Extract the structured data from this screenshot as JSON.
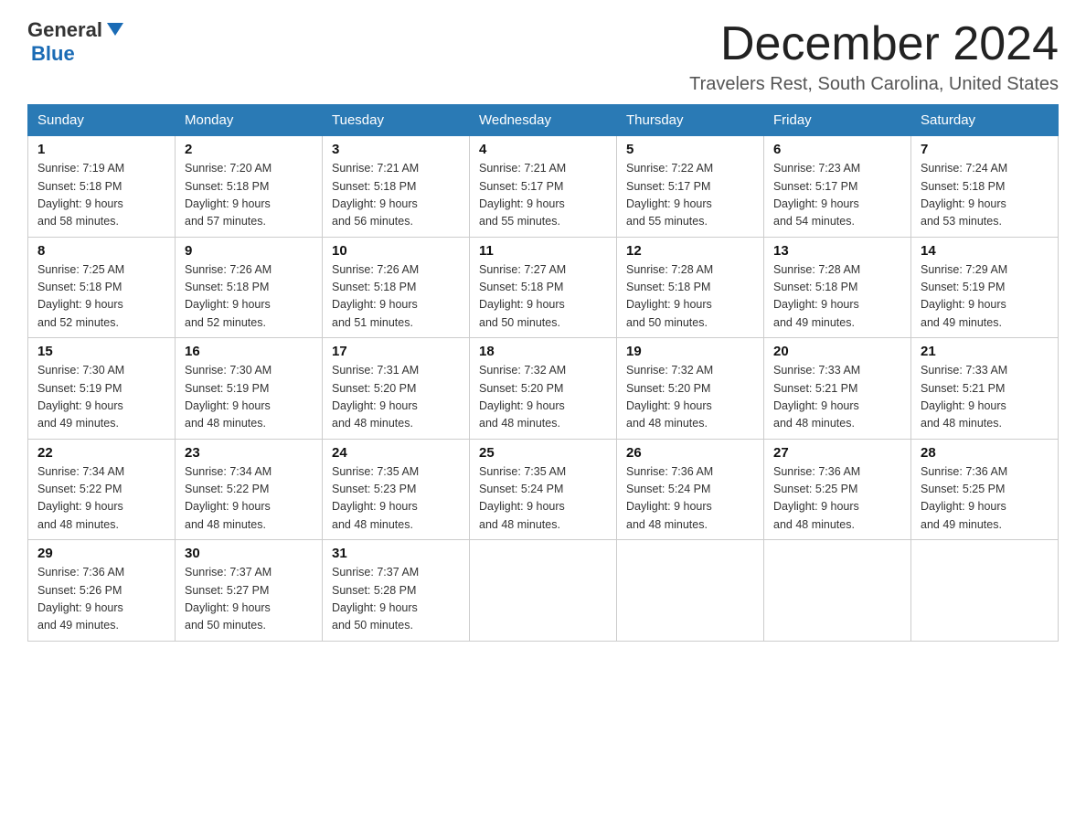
{
  "header": {
    "logo": {
      "general": "General",
      "blue": "Blue"
    },
    "title": "December 2024",
    "subtitle": "Travelers Rest, South Carolina, United States"
  },
  "weekdays": [
    "Sunday",
    "Monday",
    "Tuesday",
    "Wednesday",
    "Thursday",
    "Friday",
    "Saturday"
  ],
  "weeks": [
    [
      {
        "day": "1",
        "sunrise": "7:19 AM",
        "sunset": "5:18 PM",
        "daylight": "9 hours and 58 minutes."
      },
      {
        "day": "2",
        "sunrise": "7:20 AM",
        "sunset": "5:18 PM",
        "daylight": "9 hours and 57 minutes."
      },
      {
        "day": "3",
        "sunrise": "7:21 AM",
        "sunset": "5:18 PM",
        "daylight": "9 hours and 56 minutes."
      },
      {
        "day": "4",
        "sunrise": "7:21 AM",
        "sunset": "5:17 PM",
        "daylight": "9 hours and 55 minutes."
      },
      {
        "day": "5",
        "sunrise": "7:22 AM",
        "sunset": "5:17 PM",
        "daylight": "9 hours and 55 minutes."
      },
      {
        "day": "6",
        "sunrise": "7:23 AM",
        "sunset": "5:17 PM",
        "daylight": "9 hours and 54 minutes."
      },
      {
        "day": "7",
        "sunrise": "7:24 AM",
        "sunset": "5:18 PM",
        "daylight": "9 hours and 53 minutes."
      }
    ],
    [
      {
        "day": "8",
        "sunrise": "7:25 AM",
        "sunset": "5:18 PM",
        "daylight": "9 hours and 52 minutes."
      },
      {
        "day": "9",
        "sunrise": "7:26 AM",
        "sunset": "5:18 PM",
        "daylight": "9 hours and 52 minutes."
      },
      {
        "day": "10",
        "sunrise": "7:26 AM",
        "sunset": "5:18 PM",
        "daylight": "9 hours and 51 minutes."
      },
      {
        "day": "11",
        "sunrise": "7:27 AM",
        "sunset": "5:18 PM",
        "daylight": "9 hours and 50 minutes."
      },
      {
        "day": "12",
        "sunrise": "7:28 AM",
        "sunset": "5:18 PM",
        "daylight": "9 hours and 50 minutes."
      },
      {
        "day": "13",
        "sunrise": "7:28 AM",
        "sunset": "5:18 PM",
        "daylight": "9 hours and 49 minutes."
      },
      {
        "day": "14",
        "sunrise": "7:29 AM",
        "sunset": "5:19 PM",
        "daylight": "9 hours and 49 minutes."
      }
    ],
    [
      {
        "day": "15",
        "sunrise": "7:30 AM",
        "sunset": "5:19 PM",
        "daylight": "9 hours and 49 minutes."
      },
      {
        "day": "16",
        "sunrise": "7:30 AM",
        "sunset": "5:19 PM",
        "daylight": "9 hours and 48 minutes."
      },
      {
        "day": "17",
        "sunrise": "7:31 AM",
        "sunset": "5:20 PM",
        "daylight": "9 hours and 48 minutes."
      },
      {
        "day": "18",
        "sunrise": "7:32 AM",
        "sunset": "5:20 PM",
        "daylight": "9 hours and 48 minutes."
      },
      {
        "day": "19",
        "sunrise": "7:32 AM",
        "sunset": "5:20 PM",
        "daylight": "9 hours and 48 minutes."
      },
      {
        "day": "20",
        "sunrise": "7:33 AM",
        "sunset": "5:21 PM",
        "daylight": "9 hours and 48 minutes."
      },
      {
        "day": "21",
        "sunrise": "7:33 AM",
        "sunset": "5:21 PM",
        "daylight": "9 hours and 48 minutes."
      }
    ],
    [
      {
        "day": "22",
        "sunrise": "7:34 AM",
        "sunset": "5:22 PM",
        "daylight": "9 hours and 48 minutes."
      },
      {
        "day": "23",
        "sunrise": "7:34 AM",
        "sunset": "5:22 PM",
        "daylight": "9 hours and 48 minutes."
      },
      {
        "day": "24",
        "sunrise": "7:35 AM",
        "sunset": "5:23 PM",
        "daylight": "9 hours and 48 minutes."
      },
      {
        "day": "25",
        "sunrise": "7:35 AM",
        "sunset": "5:24 PM",
        "daylight": "9 hours and 48 minutes."
      },
      {
        "day": "26",
        "sunrise": "7:36 AM",
        "sunset": "5:24 PM",
        "daylight": "9 hours and 48 minutes."
      },
      {
        "day": "27",
        "sunrise": "7:36 AM",
        "sunset": "5:25 PM",
        "daylight": "9 hours and 48 minutes."
      },
      {
        "day": "28",
        "sunrise": "7:36 AM",
        "sunset": "5:25 PM",
        "daylight": "9 hours and 49 minutes."
      }
    ],
    [
      {
        "day": "29",
        "sunrise": "7:36 AM",
        "sunset": "5:26 PM",
        "daylight": "9 hours and 49 minutes."
      },
      {
        "day": "30",
        "sunrise": "7:37 AM",
        "sunset": "5:27 PM",
        "daylight": "9 hours and 50 minutes."
      },
      {
        "day": "31",
        "sunrise": "7:37 AM",
        "sunset": "5:28 PM",
        "daylight": "9 hours and 50 minutes."
      },
      null,
      null,
      null,
      null
    ]
  ],
  "labels": {
    "sunrise": "Sunrise:",
    "sunset": "Sunset:",
    "daylight": "Daylight:"
  }
}
